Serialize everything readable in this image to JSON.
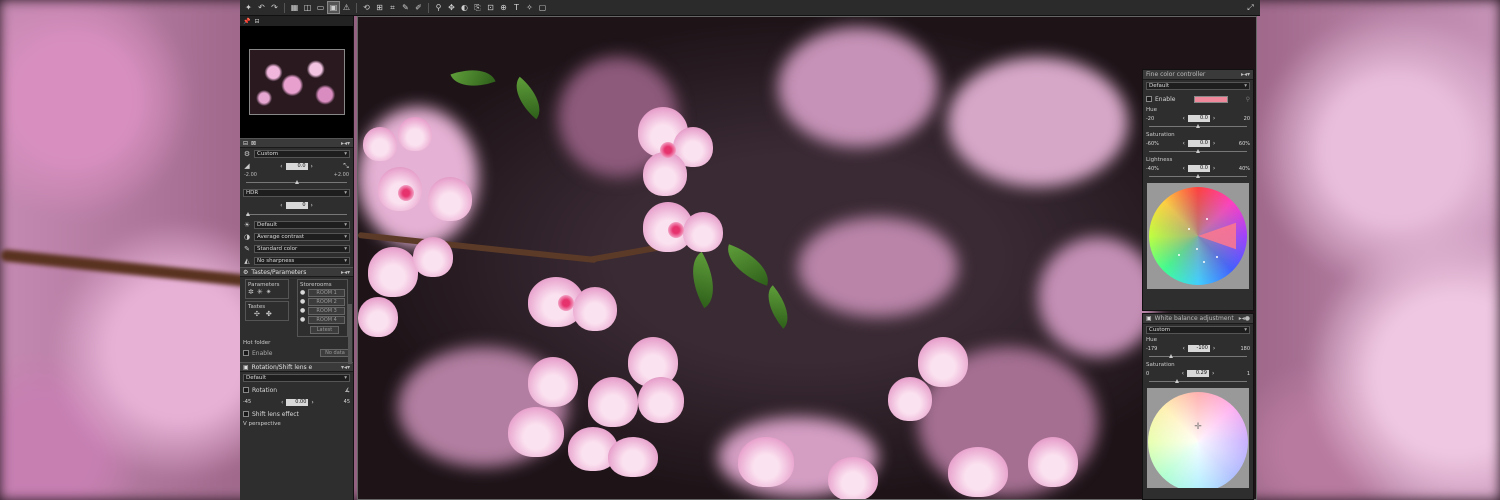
{
  "toolbar": {
    "icons": [
      "app-icon",
      "undo-icon",
      "redo-icon",
      "grid-icon",
      "compare-icon",
      "single-view-icon",
      "split-view-icon",
      "warning-icon",
      "rotate-left-icon",
      "straighten-icon",
      "crop-icon",
      "retouch-icon",
      "brush-icon",
      "dropper-icon",
      "select-icon",
      "levels-icon",
      "copy-icon",
      "paste-icon",
      "text-icon",
      "color-point-icon",
      "monitor-icon"
    ],
    "fullscreen_icon": "fullscreen-icon"
  },
  "left_panel": {
    "tabs": [
      "",
      ""
    ],
    "section1": {
      "preset": "Custom",
      "exposure_value": "0.0",
      "exposure_min": "-2.00",
      "exposure_max": "+2.00",
      "hdr_label": "HDR",
      "hdr_value": "0",
      "picture_control": "Default",
      "contrast": "Average contrast",
      "color": "Standard color",
      "sharpness": "No sharpness"
    },
    "tastes": {
      "title": "Tastes/Parameters",
      "parameters_label": "Parameters",
      "tastes_label": "Tastes",
      "storerooms_label": "Storerooms",
      "rooms": [
        "ROOM 1",
        "ROOM 2",
        "ROOM 3",
        "ROOM 4"
      ],
      "latest": "Latest",
      "hot_folder_label": "Hot folder",
      "enable_label": "Enable",
      "no_data": "No data"
    },
    "rotation": {
      "title": "Rotation/Shift lens e",
      "preset": "Default",
      "rotation_label": "Rotation",
      "rotation_min": "-45",
      "rotation_value": "0.00",
      "rotation_max": "45",
      "shift_label": "Shift lens effect",
      "vperspective_label": "V perspective"
    }
  },
  "fine_color": {
    "title": "Fine color controller",
    "preset": "Default",
    "enable_label": "Enable",
    "swatch_color": "#f0889c",
    "hue_label": "Hue",
    "hue_min": "-20",
    "hue_value": "0.0",
    "hue_max": "20",
    "hue_level": 0.5,
    "saturation_label": "Saturation",
    "sat_min": "-60%",
    "sat_value": "0.0",
    "sat_max": "60%",
    "sat_level": 0.5,
    "lightness_label": "Lightness",
    "light_min": "-40%",
    "light_value": "0.0",
    "light_max": "40%",
    "light_level": 0.5
  },
  "white_balance": {
    "title": "White balance adjustment",
    "preset": "Custom",
    "hue_label": "Hue",
    "hue_min": "-179",
    "hue_value": "-100",
    "hue_max": "180",
    "hue_level": 0.22,
    "saturation_label": "Saturation",
    "sat_min": "0",
    "sat_value": "0.29",
    "sat_max": "1",
    "sat_level": 0.29
  }
}
